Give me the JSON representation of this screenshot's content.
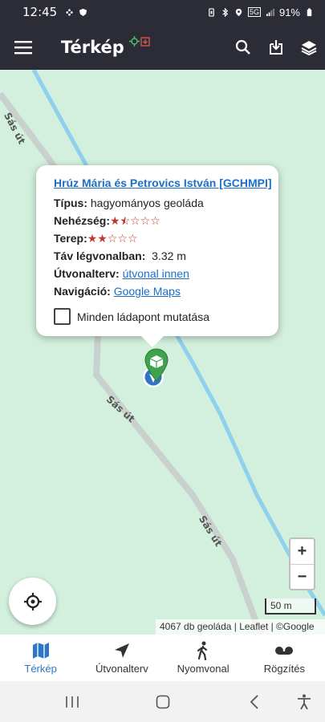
{
  "status_bar": {
    "time": "12:45",
    "network": "5G",
    "battery": "91%"
  },
  "app_bar": {
    "title": "Térkép"
  },
  "map": {
    "road_name": "Sás út"
  },
  "popup": {
    "title": "Hrúz Mária és Petrovics István [GCHMPI]",
    "type_label": "Típus:",
    "type_value": "hagyományos geoláda",
    "difficulty_label": "Nehézség:",
    "difficulty_rating": 1.5,
    "terrain_label": "Terep:",
    "terrain_rating": 2,
    "distance_label": "Táv légvonalban:",
    "distance_value": "3.32 m",
    "route_label": "Útvonalterv:",
    "route_link": "útvonal innen",
    "navigation_label": "Navigáció:",
    "navigation_link": "Google Maps",
    "checkbox_label": "Minden ládapont mutatása"
  },
  "zoom": {
    "in": "+",
    "out": "−"
  },
  "scale_label": "50 m",
  "attribution": "4067 db geoláda | Leaflet | ©Google",
  "bottom_nav": [
    {
      "label": "Térkép",
      "icon": "map-icon",
      "active": true
    },
    {
      "label": "Útvonalterv",
      "icon": "navigation-arrow-icon",
      "active": false
    },
    {
      "label": "Nyomvonal",
      "icon": "walking-person-icon",
      "active": false
    },
    {
      "label": "Rögzítés",
      "icon": "record-icon",
      "active": false
    }
  ],
  "colors": {
    "app_bar": "#2b2c36",
    "map_bg": "#d3f0de",
    "accent": "#2f77c4",
    "link": "#1a6fc9",
    "star": "#c0392b",
    "marker_green": "#3fa34d"
  }
}
